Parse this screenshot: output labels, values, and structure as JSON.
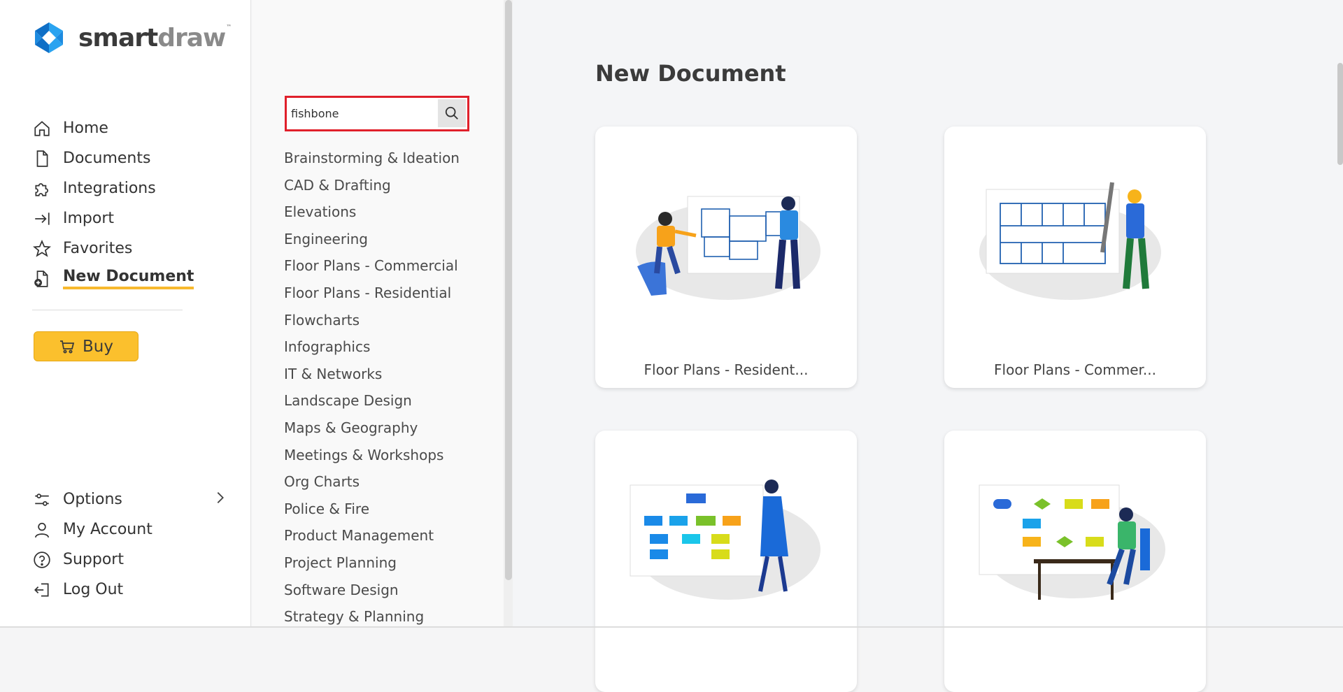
{
  "brand": {
    "part1": "smart",
    "part2": "draw",
    "tm": "™"
  },
  "nav_top": [
    {
      "label": "Home",
      "icon": "home-icon"
    },
    {
      "label": "Documents",
      "icon": "document-icon"
    },
    {
      "label": "Integrations",
      "icon": "puzzle-icon"
    },
    {
      "label": "Import",
      "icon": "import-icon"
    },
    {
      "label": "Favorites",
      "icon": "star-icon"
    },
    {
      "label": "New Document",
      "icon": "new-document-icon",
      "active": true
    }
  ],
  "buy": {
    "label": "Buy",
    "icon": "cart-icon"
  },
  "nav_bottom": [
    {
      "label": "Options",
      "icon": "sliders-icon"
    },
    {
      "label": "My Account",
      "icon": "user-icon"
    },
    {
      "label": "Support",
      "icon": "help-icon"
    },
    {
      "label": "Log Out",
      "icon": "logout-icon"
    }
  ],
  "search": {
    "value": "fishbone",
    "placeholder": ""
  },
  "categories": [
    "Brainstorming & Ideation",
    "CAD & Drafting",
    "Elevations",
    "Engineering",
    "Floor Plans - Commercial",
    "Floor Plans - Residential",
    "Flowcharts",
    "Infographics",
    "IT & Networks",
    "Landscape Design",
    "Maps & Geography",
    "Meetings & Workshops",
    "Org Charts",
    "Police & Fire",
    "Product Management",
    "Project Planning",
    "Software Design",
    "Strategy & Planning"
  ],
  "main": {
    "title": "New Document",
    "cards": [
      {
        "label": "Floor Plans - Resident..."
      },
      {
        "label": "Floor Plans - Commer..."
      },
      {
        "label": ""
      },
      {
        "label": ""
      }
    ]
  },
  "colors": {
    "accent": "#f7b92e",
    "buy": "#fbc02d",
    "search_border": "#e0202b",
    "logo_blue": "#1d8be0"
  }
}
